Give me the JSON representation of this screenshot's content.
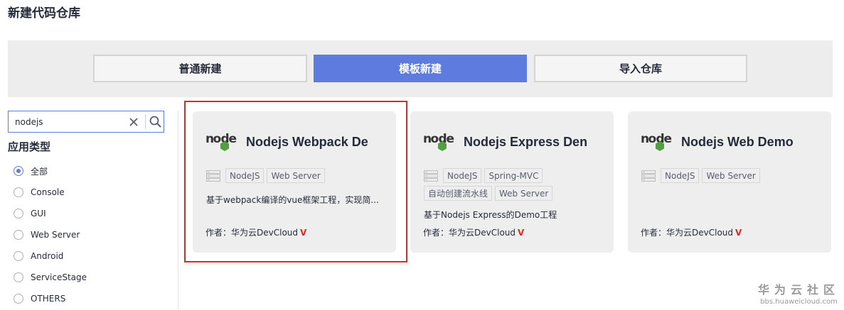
{
  "page_title": "新建代码仓库",
  "tabs": [
    {
      "label": "普通新建",
      "active": false
    },
    {
      "label": "模板新建",
      "active": true
    },
    {
      "label": "导入仓库",
      "active": false
    }
  ],
  "search": {
    "value": "nodejs",
    "clear_icon": "close-icon",
    "search_icon": "search-icon"
  },
  "filter": {
    "title": "应用类型",
    "options": [
      "全部",
      "Console",
      "GUI",
      "Web Server",
      "Android",
      "ServiceStage",
      "OTHERS"
    ],
    "selected": "全部"
  },
  "cards": [
    {
      "title": "Nodejs Webpack De",
      "tags": [
        "NodeJS",
        "Web Server"
      ],
      "description": "基于webpack编译的vue框架工程，实现简...",
      "author": "作者：华为云DevCloud",
      "selected": true
    },
    {
      "title": "Nodejs Express Den",
      "tags": [
        "NodeJS",
        "Spring-MVC",
        "自动创建流水线",
        "Web Server"
      ],
      "description": "基于Nodejs Express的Demo工程",
      "author": "作者：华为云DevCloud",
      "selected": false
    },
    {
      "title": "Nodejs Web Demo",
      "tags": [
        "NodeJS",
        "Web Server"
      ],
      "description": "",
      "author": "作者：华为云DevCloud",
      "selected": false
    }
  ],
  "verified_mark": "V",
  "watermark": {
    "main": "华为云社区",
    "sub": "bbs.huaweicloud.com"
  },
  "colors": {
    "accent": "#5e7ce0",
    "highlight": "#e0281e",
    "node_green": "#539e43"
  }
}
